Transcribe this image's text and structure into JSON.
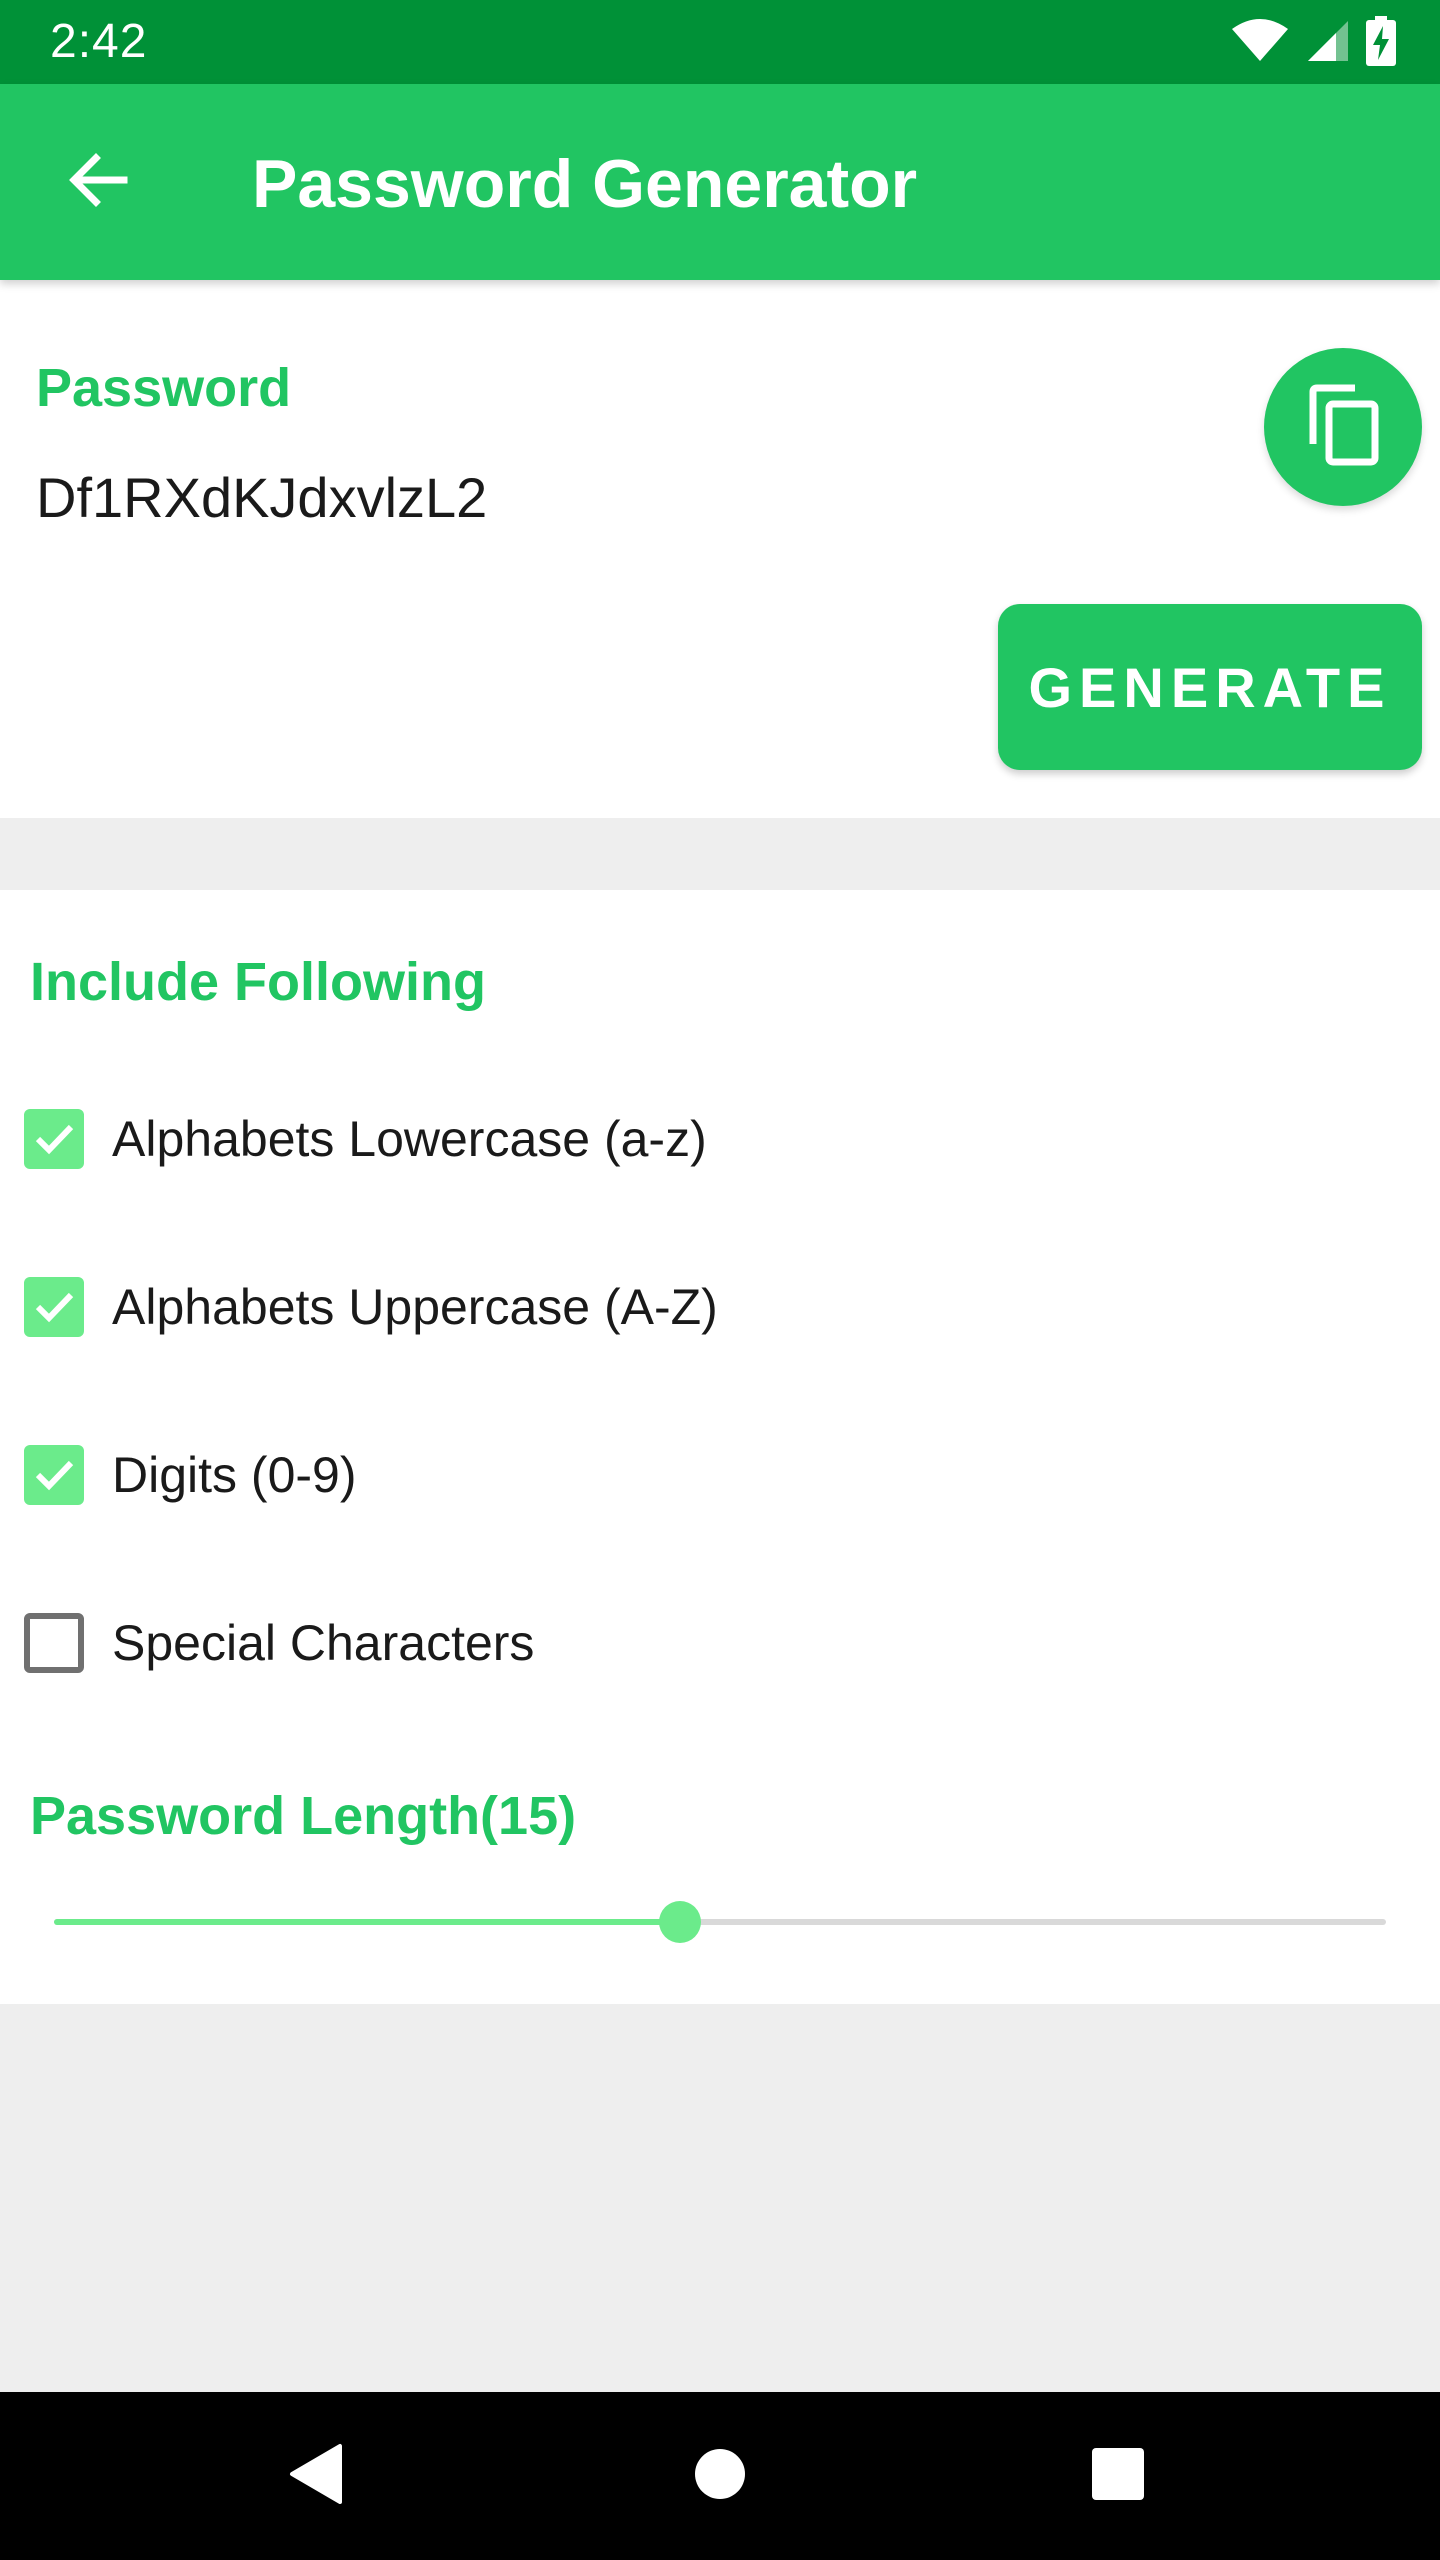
{
  "status_bar": {
    "time": "2:42",
    "icons": [
      "wifi-icon",
      "cell-signal-icon",
      "battery-charging-icon"
    ]
  },
  "app_bar": {
    "title": "Password Generator",
    "back_icon": "arrow-back-icon"
  },
  "password_section": {
    "label": "Password",
    "value": "Df1RXdKJdxvlzL2",
    "copy_icon": "copy-icon",
    "generate_label": "GENERATE"
  },
  "include_section": {
    "title": "Include Following",
    "options": [
      {
        "label": "Alphabets Lowercase (a-z)",
        "checked": true
      },
      {
        "label": "Alphabets Uppercase (A-Z)",
        "checked": true
      },
      {
        "label": "Digits (0-9)",
        "checked": true
      },
      {
        "label": "Special Characters",
        "checked": false
      }
    ]
  },
  "length_section": {
    "title": "Password Length(15)",
    "slider_fraction": 0.47
  },
  "nav_bar": {
    "icons": [
      "nav-back-icon",
      "nav-home-icon",
      "nav-recents-icon"
    ]
  },
  "colors": {
    "status_bar": "#009137",
    "primary": "#21C562",
    "accent_light": "#6BEB8B",
    "background": "#EEEEEE"
  }
}
